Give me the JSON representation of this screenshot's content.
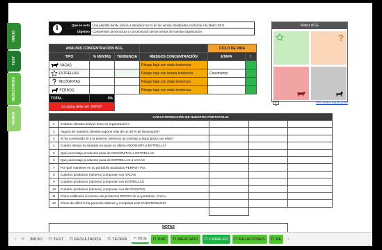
{
  "side_tabs": [
    {
      "label": "INICIO",
      "color": "#2e8b2e"
    },
    {
      "label": "TEST",
      "color": "#1e7a2a"
    },
    {
      "label": "RESULTADOS",
      "color": "#5fbf45"
    },
    {
      "label": "TEORÍA",
      "color": "#8fd36a"
    }
  ],
  "info": {
    "icon": "i",
    "row1_label": "Qué es esto",
    "row1_text": "Una plantilla donde vamos a introducir los % de las ventas clasificadas conforme a la Matriz BCG",
    "row2_label": "Objetivo",
    "row2_text": "Comprender la estructura y concentración de las ventas de nuestra organización."
  },
  "analysis": {
    "title": "ANÁLISIS CONCENTRACIÓN BCG",
    "cycle_title": "CICLO DE VIDA",
    "headers": {
      "tipo": "TIPO",
      "ventas": "% VENTAS",
      "tendencia": "TENDENCIA",
      "riesgos": "RIESGOS CONCENTRACIÓN",
      "etapa": "ETAPA",
      "bang": "!"
    },
    "rows": [
      {
        "tipo": "VACAS",
        "icon": "cow-icon",
        "riesgo": "Riesgo bajo con mala tendencia",
        "etapa": ""
      },
      {
        "tipo": "ESTRELLAS",
        "icon": "star-icon",
        "riesgo": "Riesgo bajo con buena tendencia",
        "etapa": "Crecimiento"
      },
      {
        "tipo": "INCÓGNITAS",
        "icon": "question-icon",
        "riesgo": "Riesgo bajo con mala tendencia",
        "etapa": ""
      },
      {
        "tipo": "PERROS",
        "icon": "dog-icon",
        "riesgo": "Riesgo bajo con mala tendencia",
        "etapa": ""
      }
    ],
    "total_label": "TOTAL",
    "total_value": "0%",
    "warning": "La suma debe ser 100%!!!"
  },
  "bcg": {
    "title": "Matriz BCG",
    "video_link": "Ver vídeo explicativo",
    "colors": {
      "star": "#c8ecc0",
      "question": "#fbd6b8",
      "cow": "#f2a3a3",
      "dog": "#c8c8c8"
    }
  },
  "characterization": {
    "title": "CARACTERIZACIÓN DE NUESTRO PORTAFOLIO",
    "rows": [
      {
        "n": "1",
        "q": "Cuántos clientes activos tiene su organización?"
      },
      {
        "n": "2",
        "q": "Alguno de nuestros clientes supone más de un 30 % de facturación?"
      },
      {
        "n": "3",
        "q": "Si ha contestado Sí a la anterior, tenemos un contrato a largo plazo con ellos?"
      },
      {
        "n": "4",
        "q": "Cuánto tiempo ha tardado en pasar su última INCÓGNITA a ESTRELLA?"
      },
      {
        "n": "5",
        "q": "Qué porcentaje productos pasa de INCÓGNITAS a ESTRELLAS"
      },
      {
        "n": "6",
        "q": "Qué porcentaje productos pasa de ESTRELLAS a VACAS"
      },
      {
        "n": "7",
        "q": "Por qué mantiene en su portafolio productos PERRO? Por.."
      },
      {
        "n": "8",
        "q": "Cuántos productos (número) componen sus VACAS"
      },
      {
        "n": "9",
        "q": "Cuántos productos (número) componen sus ESTRELLAS"
      },
      {
        "n": "10",
        "q": "Cuántos productos (número) componen sus INCÓGNITAS"
      },
      {
        "n": "11",
        "q": "Cómo calificaría el número de productos PERRO de su portafolio. Como.."
      },
      {
        "n": "12",
        "q": "Cómo de difícil le ha parecido obtener y completar este CUESTIONARIO"
      }
    ]
  },
  "notes": {
    "title": "NOTAS"
  },
  "sheet_tabs": [
    {
      "label": "INICIO",
      "locked": false,
      "style": "plain"
    },
    {
      "label": "TEST",
      "locked": true,
      "style": "plain"
    },
    {
      "label": "RESULTADOS",
      "locked": true,
      "style": "plain"
    },
    {
      "label": "TEORIA",
      "locked": true,
      "style": "plain"
    },
    {
      "label": "BCG",
      "locked": true,
      "style": "active"
    },
    {
      "label": "PMC",
      "locked": true,
      "style": "g"
    },
    {
      "label": "MERCADO",
      "locked": true,
      "style": "g"
    },
    {
      "label": "CANALES",
      "locked": true,
      "style": "g2"
    },
    {
      "label": "RELACIONES",
      "locked": true,
      "style": "g"
    },
    {
      "label": "RE",
      "locked": true,
      "style": "g"
    }
  ]
}
